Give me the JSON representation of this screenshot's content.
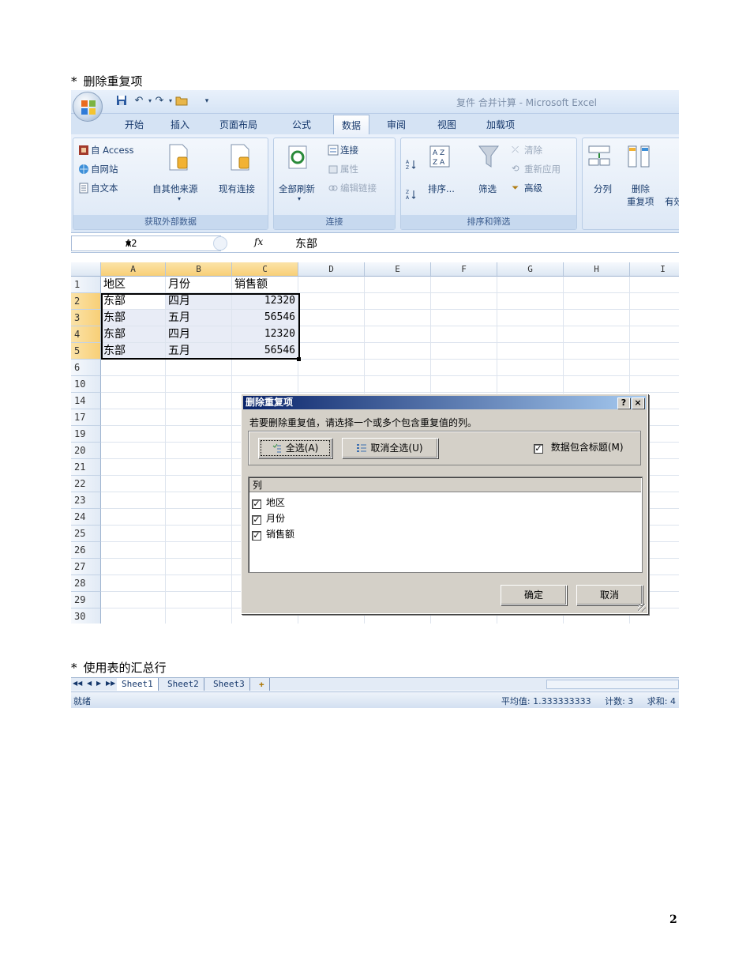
{
  "bullets": {
    "first": "删除重复项",
    "second": "使用表的汇总行",
    "symbol": "*"
  },
  "excel": {
    "window_title": "复件 合并计算 - Microsoft Excel",
    "tabs": [
      "开始",
      "插入",
      "页面布局",
      "公式",
      "数据",
      "审阅",
      "视图",
      "加载项"
    ],
    "active_tab": "数据",
    "ribbon": {
      "get_external": {
        "from_access": "自 Access",
        "from_web": "自网站",
        "from_text": "自文本",
        "other_sources": "自其他来源",
        "existing_conn": "现有连接",
        "label": "获取外部数据"
      },
      "connections": {
        "refresh_all": "全部刷新",
        "connections": "连接",
        "properties": "属性",
        "edit_links": "编辑链接",
        "label": "连接"
      },
      "sort_filter": {
        "sort": "排序...",
        "filter": "筛选",
        "clear": "清除",
        "reapply": "重新应用",
        "advanced": "高级",
        "label": "排序和筛选"
      },
      "data_tools": {
        "text_to_columns": "分列",
        "remove_dup_1": "删除",
        "remove_dup_2": "重复项",
        "validity": "有效"
      }
    },
    "formula_bar": {
      "name_box": "A2",
      "fx": "fx",
      "value": "东部"
    },
    "columns": [
      "A",
      "B",
      "C",
      "D",
      "E",
      "F",
      "G",
      "H",
      "I"
    ],
    "rows": [
      {
        "num": "1",
        "cells": [
          "地区",
          "月份",
          "销售额"
        ]
      },
      {
        "num": "2",
        "cells": [
          "东部",
          "四月",
          "12320"
        ]
      },
      {
        "num": "3",
        "cells": [
          "东部",
          "五月",
          "56546"
        ]
      },
      {
        "num": "4",
        "cells": [
          "东部",
          "四月",
          "12320"
        ]
      },
      {
        "num": "5",
        "cells": [
          "东部",
          "五月",
          "56546"
        ]
      },
      {
        "num": "6",
        "cells": [
          "",
          "",
          ""
        ]
      },
      {
        "num": "10",
        "cells": [
          "",
          "",
          ""
        ]
      },
      {
        "num": "14",
        "cells": [
          "",
          "",
          ""
        ]
      },
      {
        "num": "17",
        "cells": [
          "",
          "",
          ""
        ]
      },
      {
        "num": "19",
        "cells": [
          "",
          "",
          ""
        ]
      },
      {
        "num": "20",
        "cells": [
          "",
          "",
          ""
        ]
      },
      {
        "num": "21",
        "cells": [
          "",
          "",
          ""
        ]
      },
      {
        "num": "22",
        "cells": [
          "",
          "",
          ""
        ]
      },
      {
        "num": "23",
        "cells": [
          "",
          "",
          ""
        ]
      },
      {
        "num": "24",
        "cells": [
          "",
          "",
          ""
        ]
      },
      {
        "num": "25",
        "cells": [
          "",
          "",
          ""
        ]
      },
      {
        "num": "26",
        "cells": [
          "",
          "",
          ""
        ]
      },
      {
        "num": "27",
        "cells": [
          "",
          "",
          ""
        ]
      },
      {
        "num": "28",
        "cells": [
          "",
          "",
          ""
        ]
      },
      {
        "num": "29",
        "cells": [
          "",
          "",
          ""
        ]
      },
      {
        "num": "30",
        "cells": [
          "",
          "",
          ""
        ]
      }
    ],
    "dialog": {
      "title": "删除重复项",
      "help": "?",
      "close": "×",
      "prompt": "若要删除重复值，请选择一个或多个包含重复值的列。",
      "select_all": "全选(A)",
      "unselect_all": "取消全选(U)",
      "has_headers": "数据包含标题(M)",
      "list_header": "列",
      "columns": [
        "地区",
        "月份",
        "销售额"
      ],
      "ok": "确定",
      "cancel": "取消"
    },
    "sheet_tabs": [
      "Sheet1",
      "Sheet2",
      "Sheet3"
    ],
    "status": {
      "ready": "就绪",
      "average": "平均值: 1.333333333",
      "count": "计数: 3",
      "sum": "求和: 4"
    }
  },
  "page_number": "2"
}
